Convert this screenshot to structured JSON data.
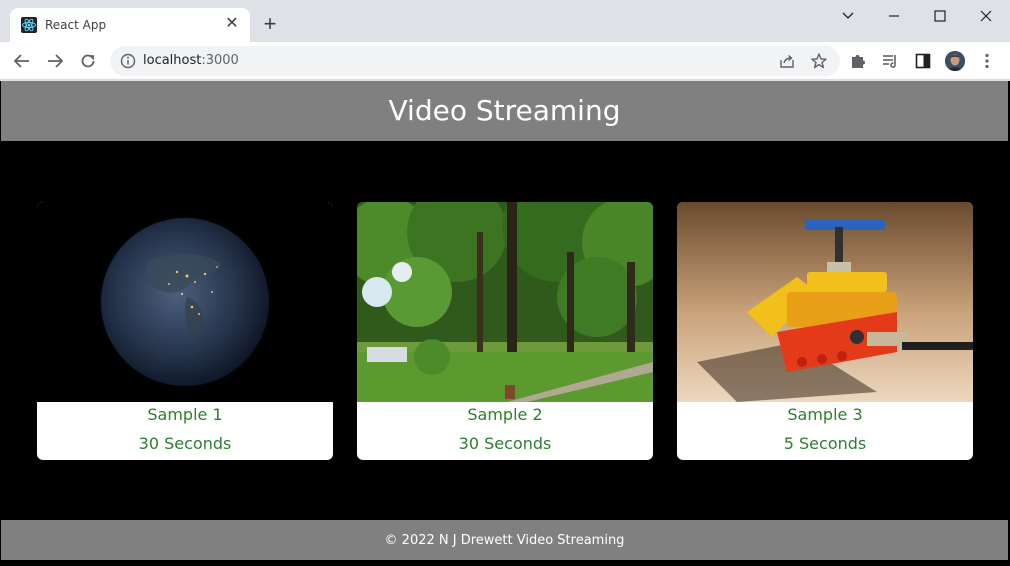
{
  "browser": {
    "tab_title": "React App",
    "url_host": "localhost",
    "url_port": ":3000",
    "icons": {
      "favicon": "react-logo-icon",
      "close": "close-icon",
      "new_tab": "plus-icon",
      "back": "back-arrow-icon",
      "forward": "forward-arrow-icon",
      "reload": "reload-icon",
      "site_info": "info-icon",
      "share": "share-icon",
      "bookmark": "star-icon",
      "extensions": "puzzle-icon",
      "media": "media-queue-icon",
      "side_panel": "side-panel-icon",
      "menu": "kebab-menu-icon",
      "tab_search": "chevron-down-icon",
      "minimize": "minimize-icon",
      "maximize": "maximize-icon",
      "window_close": "window-close-icon"
    },
    "tab_close_glyph": "✕",
    "new_tab_glyph": "+"
  },
  "site": {
    "title": "Video Streaming",
    "footer": "© 2022 N J Drewett Video Streaming",
    "colors": {
      "header_bg": "#808080",
      "body_bg": "#000000",
      "card_text": "#2e7d32"
    }
  },
  "videos": [
    {
      "title": "Sample 1",
      "duration": "30 Seconds",
      "thumbnail": "earth-at-night"
    },
    {
      "title": "Sample 2",
      "duration": "30 Seconds",
      "thumbnail": "park-trees"
    },
    {
      "title": "Sample 3",
      "duration": "5 Seconds",
      "thumbnail": "lego-helicopter"
    }
  ]
}
